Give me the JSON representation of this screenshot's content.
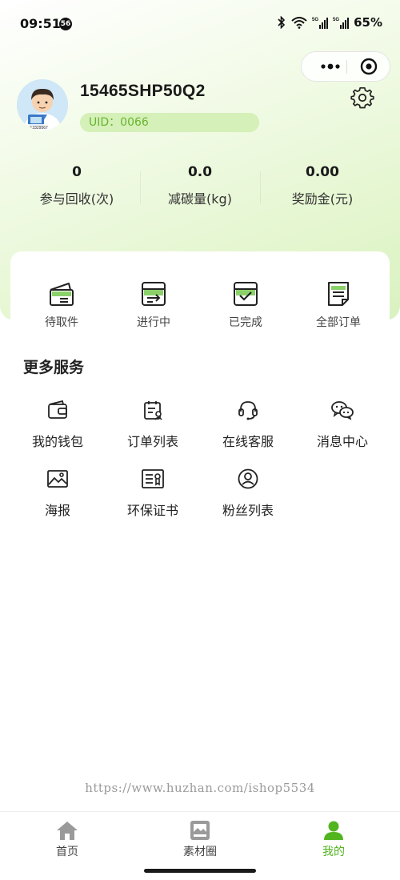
{
  "status_bar": {
    "time": "09:51",
    "badge": "56",
    "network_1": "5G",
    "network_2": "5G",
    "battery": "65%"
  },
  "profile": {
    "username": "15465SHP50Q2",
    "uid": "UID：0066",
    "avatar_caption": "TEL:13329567"
  },
  "stats": [
    {
      "value": "0",
      "label": "参与回收(次)"
    },
    {
      "value": "0.0",
      "label": "减碳量(kg)"
    },
    {
      "value": "0.00",
      "label": "奖励金(元)"
    }
  ],
  "orders": [
    {
      "label": "待取件",
      "icon": "pickup-box-icon"
    },
    {
      "label": "进行中",
      "icon": "in-progress-box-icon"
    },
    {
      "label": "已完成",
      "icon": "completed-box-icon"
    },
    {
      "label": "全部订单",
      "icon": "all-orders-icon"
    }
  ],
  "more_services": {
    "title": "更多服务",
    "items": [
      {
        "label": "我的钱包",
        "icon": "wallet-icon"
      },
      {
        "label": "订单列表",
        "icon": "order-list-icon"
      },
      {
        "label": "在线客服",
        "icon": "headset-icon"
      },
      {
        "label": "消息中心",
        "icon": "chat-bubbles-icon"
      },
      {
        "label": "海报",
        "icon": "image-poster-icon"
      },
      {
        "label": "环保证书",
        "icon": "certificate-icon"
      },
      {
        "label": "粉丝列表",
        "icon": "user-circle-icon"
      }
    ]
  },
  "watermark": "https://www.huzhan.com/ishop5534",
  "tabbar": {
    "tabs": [
      {
        "label": "首页",
        "icon": "home-icon"
      },
      {
        "label": "素材圈",
        "icon": "gallery-icon"
      },
      {
        "label": "我的",
        "icon": "person-icon"
      }
    ],
    "active_index": 2,
    "active_color": "#52b520"
  },
  "colors": {
    "accent": "#52b520",
    "uid_text": "#67b52e",
    "uid_bg": "#d5f0b8",
    "icon_green": "#8bd16a"
  }
}
